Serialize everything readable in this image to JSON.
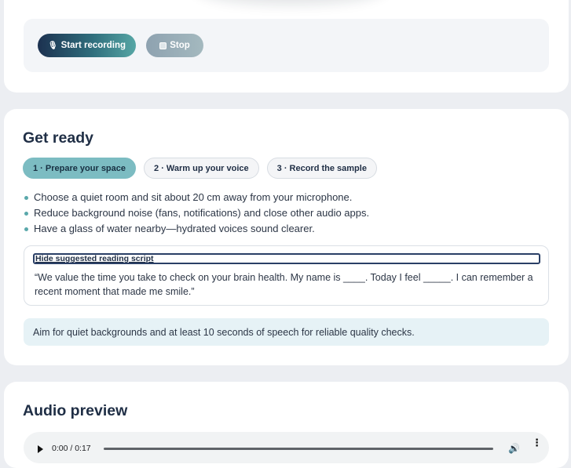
{
  "recording": {
    "start_label": "Start recording",
    "start_icon": "🎙",
    "stop_label": "Stop"
  },
  "get_ready": {
    "title": "Get ready",
    "steps": [
      "1 · Prepare your space",
      "2 · Warm up your voice",
      "3 · Record the sample"
    ],
    "active_step": 0,
    "tips": [
      "Choose a quiet room and sit about 20 cm away from your microphone.",
      "Reduce background noise (fans, notifications) and close other audio apps.",
      "Have a glass of water nearby—hydrated voices sound clearer."
    ],
    "script_toggle_label": "Hide suggested reading script",
    "script_text": "“We value the time you take to check on your brain health. My name is ____. Today I feel _____. I can remember a recent moment that made me smile.”",
    "note": "Aim for quiet backgrounds and at least 10 seconds of speech for reliable quality checks."
  },
  "audio_preview": {
    "title": "Audio preview",
    "time": "0:00 / 0:17",
    "progress": 0
  },
  "colors": {
    "accent": "#5aa8ab",
    "primary_dark": "#1c3150",
    "note_bg": "#e6f2f6"
  }
}
